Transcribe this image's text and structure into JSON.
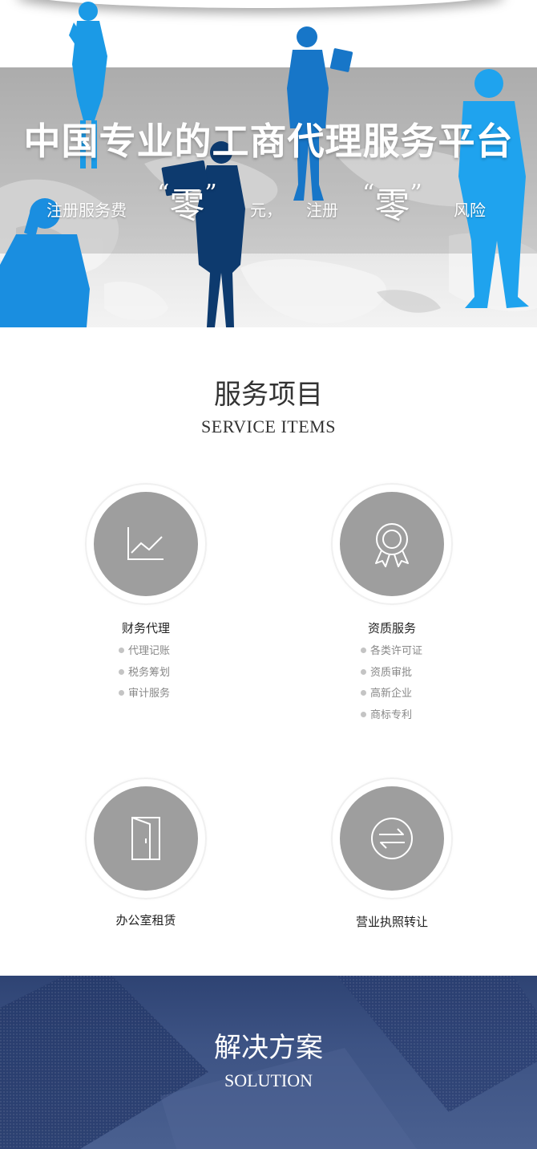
{
  "hero": {
    "title": "中国专业的工商代理服务平台",
    "sub_part1": "注册服务费",
    "zero1": "零",
    "sub_part2": "元，",
    "sub_part3": "注册",
    "zero2": "零",
    "sub_part4": "风险",
    "quote_open": "“",
    "quote_close": "”"
  },
  "services_section": {
    "title": "服务项目",
    "subtitle": "SERVICE ITEMS",
    "items": [
      {
        "name": "财务代理",
        "icon": "line-chart-icon",
        "bullets": [
          "代理记账",
          "税务筹划",
          "审计服务"
        ]
      },
      {
        "name": "资质服务",
        "icon": "award-badge-icon",
        "bullets": [
          "各类许可证",
          "资质审批",
          "高新企业",
          "商标专利"
        ]
      },
      {
        "name": "办公室租赁",
        "icon": "door-icon",
        "bullets": []
      },
      {
        "name": "营业执照转让",
        "icon": "transfer-arrows-icon",
        "bullets": []
      }
    ]
  },
  "solution_section": {
    "title": "解决方案",
    "subtitle": "SOLUTION"
  },
  "colors": {
    "icon_circle": "#9e9e9e",
    "silhouette_blue": "#1a8ee0",
    "silhouette_dark": "#0d3a6e",
    "solution_bg": "#3a4f80"
  }
}
